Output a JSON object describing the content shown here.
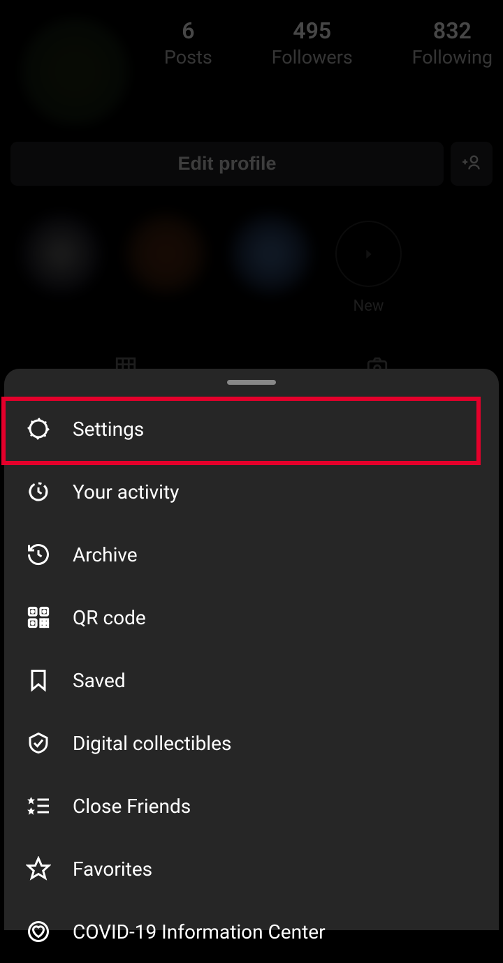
{
  "profile": {
    "stats": {
      "posts_value": "6",
      "posts_label": "Posts",
      "followers_value": "495",
      "followers_label": "Followers",
      "following_value": "832",
      "following_label": "Following"
    },
    "edit_profile_label": "Edit profile",
    "highlight_new_label": "New"
  },
  "menu": {
    "items": [
      {
        "label": "Settings",
        "icon": "gear"
      },
      {
        "label": "Your activity",
        "icon": "clock-activity"
      },
      {
        "label": "Archive",
        "icon": "archive"
      },
      {
        "label": "QR code",
        "icon": "qr"
      },
      {
        "label": "Saved",
        "icon": "bookmark"
      },
      {
        "label": "Digital collectibles",
        "icon": "shield-check"
      },
      {
        "label": "Close Friends",
        "icon": "star-list"
      },
      {
        "label": "Favorites",
        "icon": "star"
      },
      {
        "label": "COVID-19 Information Center",
        "icon": "heart-badge"
      }
    ]
  }
}
